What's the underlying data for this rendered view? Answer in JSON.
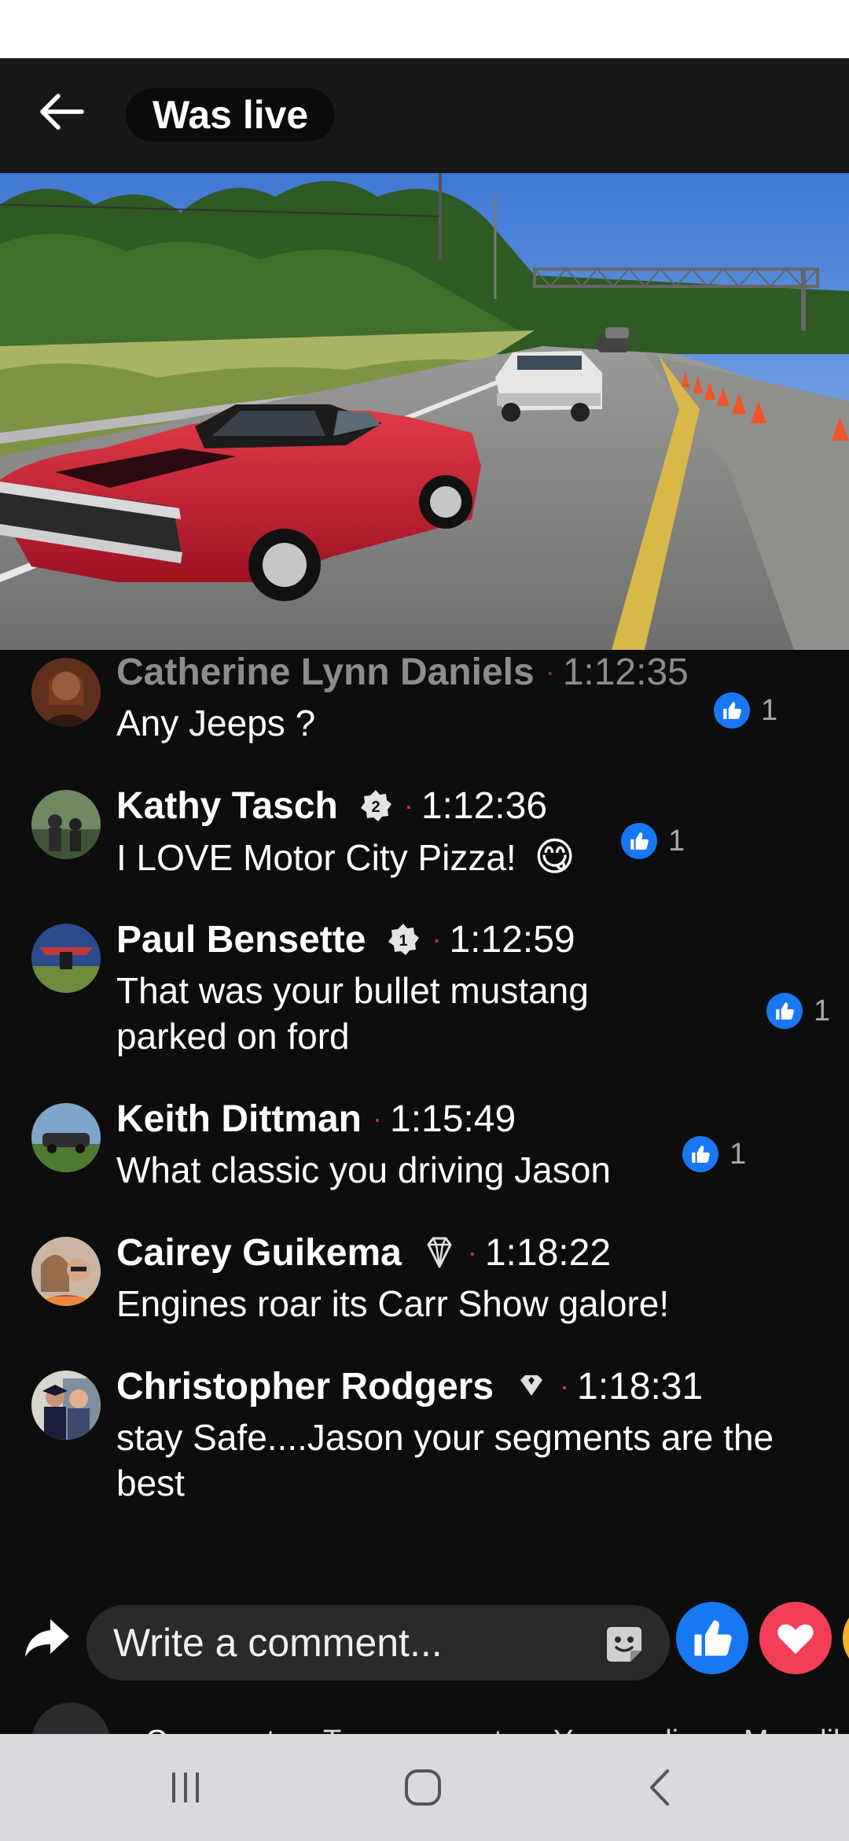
{
  "header": {
    "title": "Was live",
    "back_icon": "arrow-left-icon"
  },
  "colors": {
    "background": "#0d0d0e",
    "topbar": "#181818",
    "like_blue": "#1877f2",
    "love_red": "#f33e58",
    "dot_red": "#e0324a",
    "navbar": "#d9dade"
  },
  "comments": [
    {
      "name": "Catherine Lynn Daniels",
      "time": "1:12:35",
      "text": "Any Jeeps ?",
      "likes": "1",
      "badge": null
    },
    {
      "name": "Kathy Tasch",
      "time": "1:12:36",
      "text": "I LOVE Motor City Pizza!",
      "emoji": "😋",
      "likes": "1",
      "badge": "fan-badge-2-icon"
    },
    {
      "name": "Paul Bensette",
      "time": "1:12:59",
      "text": "That was your bullet mustang parked on ford",
      "likes": "1",
      "badge": "fan-badge-1-icon"
    },
    {
      "name": "Keith Dittman",
      "time": "1:15:49",
      "text": "What classic you driving Jason",
      "likes": "1",
      "badge": null
    },
    {
      "name": "Cairey Guikema",
      "time": "1:18:22",
      "text": "Engines roar its Carr Show galore!",
      "likes": null,
      "badge": "diamond-badge-icon"
    },
    {
      "name": "Christopher Rodgers",
      "time": "1:18:31",
      "text": "stay Safe....Jason your segments are the best",
      "likes": null,
      "badge": "heart-badge-icon"
    }
  ],
  "composer": {
    "placeholder": "Write a comment...",
    "share_icon": "share-arrow-icon",
    "sticker_icon": "sticker-icon",
    "reactions": [
      "like-reaction-icon",
      "love-reaction-icon",
      "haha-reaction-icon"
    ]
  },
  "tabs": {
    "items": [
      "Comments",
      "Top comments",
      "Your replies",
      "More lik"
    ],
    "active": "Comments",
    "collapse_icon": "chevron-down-icon"
  },
  "navbar": {
    "icons": [
      "recent-apps-icon",
      "home-icon",
      "back-icon"
    ]
  }
}
